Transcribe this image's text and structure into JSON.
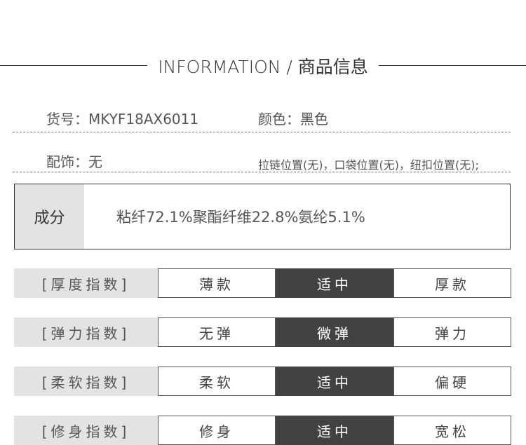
{
  "header": {
    "title": "INFORMATION / 商品信息"
  },
  "info": {
    "item_no": "货号：MKYF18AX6011",
    "color": "颜色：黑色",
    "accessory": "配饰：无",
    "accessory_detail": "拉链位置(无)，口袋位置(无)，纽扣位置(无);"
  },
  "composition": {
    "label": "成分",
    "value": "粘纤72.1%聚酯纤维22.8%氨纶5.1%"
  },
  "scales": [
    {
      "label": "[厚度指数]",
      "options": [
        "薄款",
        "适中",
        "厚款"
      ],
      "selected": 1
    },
    {
      "label": "[弹力指数]",
      "options": [
        "无弹",
        "微弹",
        "弹力"
      ],
      "selected": 1
    },
    {
      "label": "[柔软指数]",
      "options": [
        "柔软",
        "适中",
        "偏硬"
      ],
      "selected": 1
    },
    {
      "label": "[修身指数]",
      "options": [
        "修身",
        "适中",
        "宽松"
      ],
      "selected": 1
    }
  ]
}
